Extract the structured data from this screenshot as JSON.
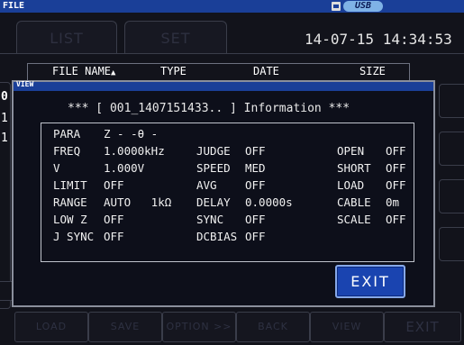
{
  "titlebar": {
    "title": "FILE",
    "usb_badge": "USB"
  },
  "tabs": [
    {
      "label": "LIST"
    },
    {
      "label": "SET"
    }
  ],
  "datetime": "14-07-15 14:34:53",
  "file_list": {
    "columns": [
      "FILE NAME",
      "TYPE",
      "DATE",
      "SIZE"
    ],
    "sort_indicator": "▲",
    "visible_row_digits": [
      "0",
      "1",
      "1"
    ]
  },
  "view_window": {
    "title": "VIEW",
    "info_line": "*** [ 001_1407151433.. ] Information ***",
    "params": {
      "col1": [
        {
          "label": "PARA",
          "value": "Z - -θ -"
        },
        {
          "label": "FREQ",
          "value": "1.0000kHz"
        },
        {
          "label": "V",
          "value": "1.000V"
        },
        {
          "label": "LIMIT",
          "value": "OFF"
        },
        {
          "label": "RANGE",
          "value": "AUTO   1kΩ"
        },
        {
          "label": "LOW Z",
          "value": "OFF"
        },
        {
          "label": "J SYNC",
          "value": "OFF"
        }
      ],
      "col2": [
        {
          "label": "JUDGE",
          "value": "OFF"
        },
        {
          "label": "SPEED",
          "value": "MED"
        },
        {
          "label": "AVG",
          "value": "OFF"
        },
        {
          "label": "DELAY",
          "value": "0.0000s"
        },
        {
          "label": "SYNC",
          "value": "OFF"
        },
        {
          "label": "DCBIAS",
          "value": "OFF"
        }
      ],
      "col3": [
        {
          "label": "OPEN",
          "value": "OFF"
        },
        {
          "label": "SHORT",
          "value": "OFF"
        },
        {
          "label": "LOAD",
          "value": "OFF"
        },
        {
          "label": "CABLE",
          "value": "0m"
        },
        {
          "label": "SCALE",
          "value": "OFF"
        }
      ]
    },
    "exit_label": "EXIT"
  },
  "softkeys": [
    "LOAD",
    "SAVE",
    "OPTION >>",
    "BACK",
    "VIEW",
    "EXIT"
  ],
  "colors": {
    "title_bar": "#1a3f98",
    "exit_button": "#1a44b0",
    "background": "#12131b"
  }
}
